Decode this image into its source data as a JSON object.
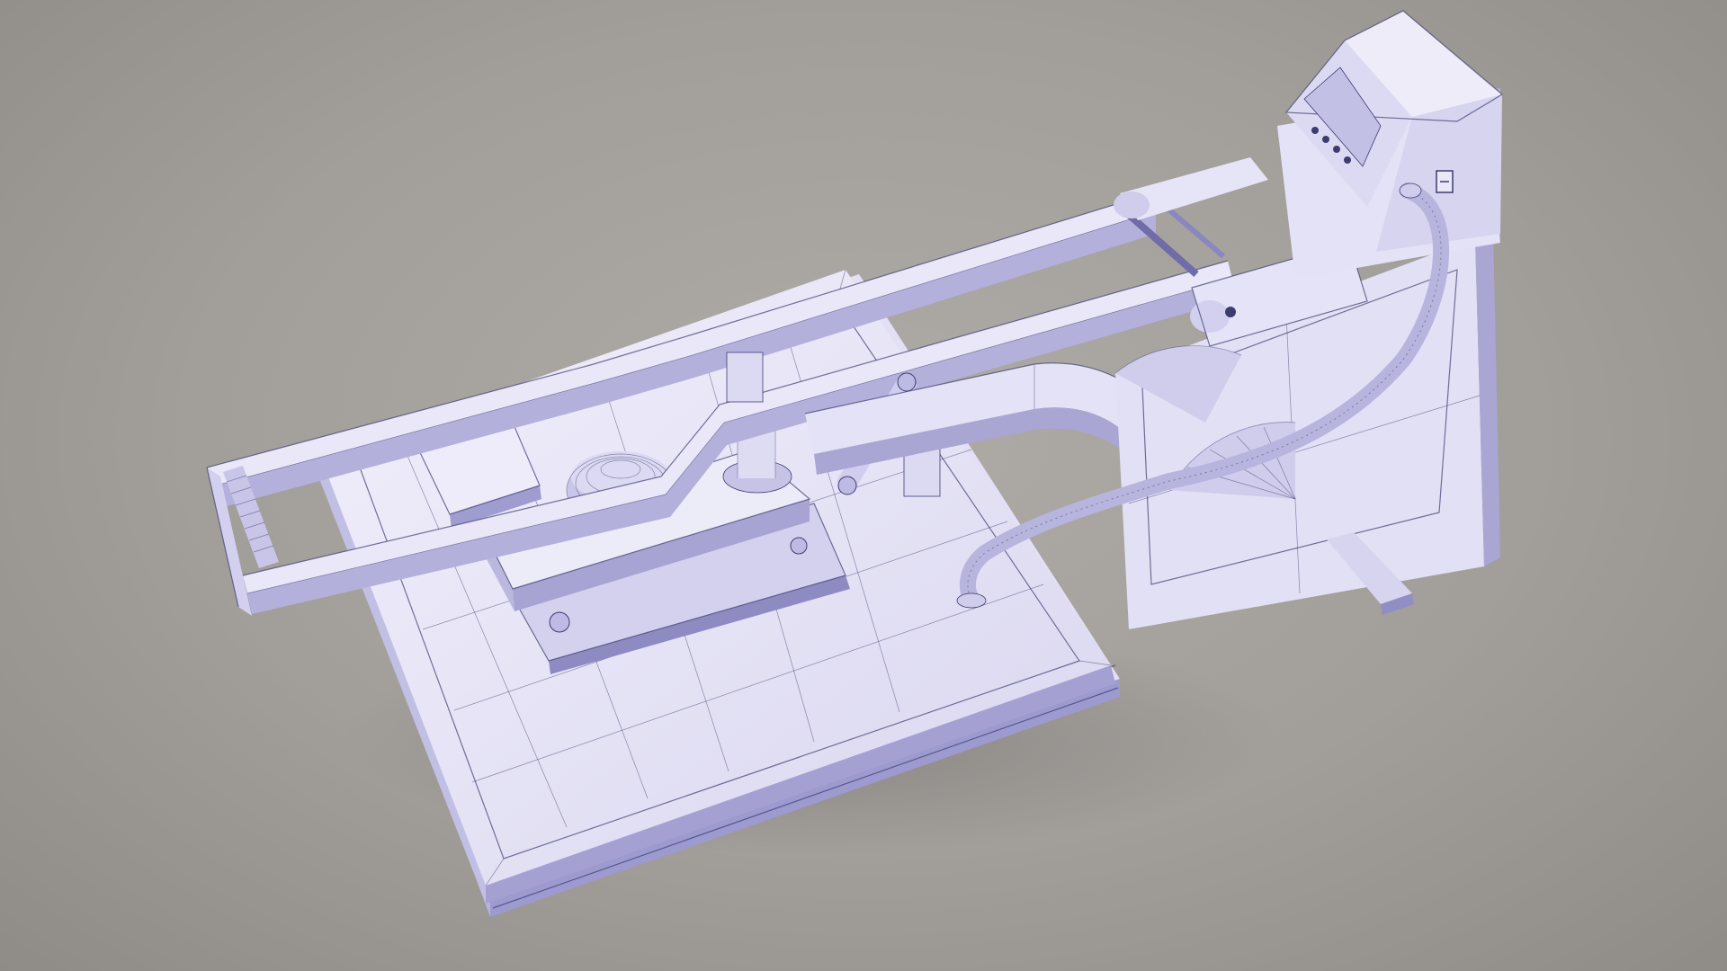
{
  "scene": {
    "subject": "heat-press-wireframe-model",
    "colors": {
      "background": "#a6a29e",
      "surface_light": "#eceaf8",
      "surface_mid": "#d6d3ee",
      "surface_dark": "#a9a6d3",
      "wire": "#3c3c6e"
    }
  }
}
